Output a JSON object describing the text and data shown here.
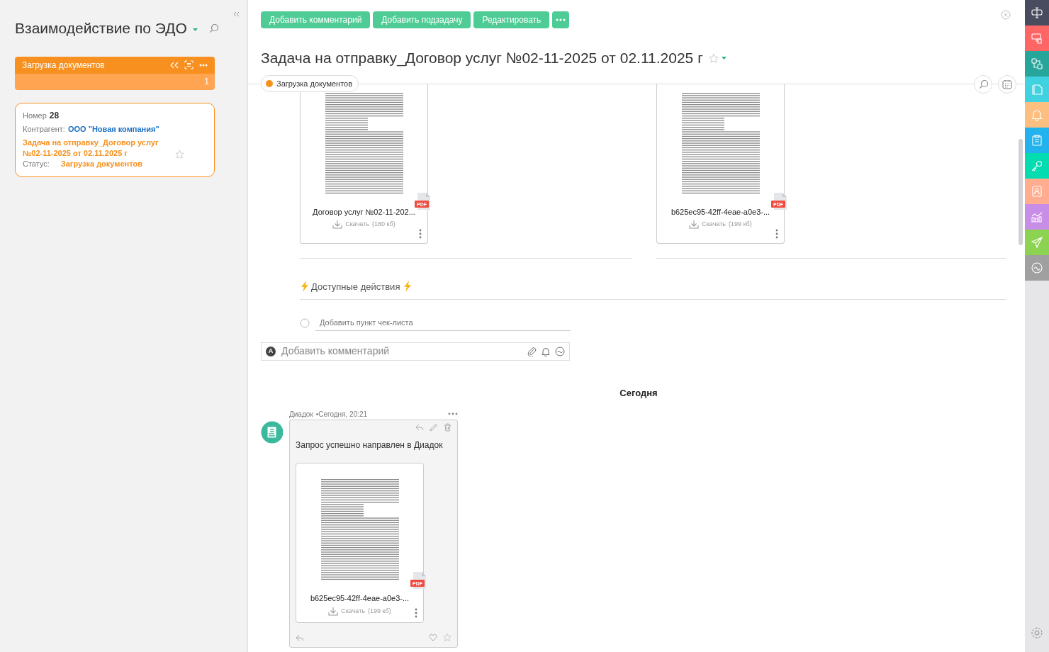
{
  "sidebar": {
    "title": "Взаимодействие по ЭДО",
    "column": {
      "title": "Загрузка документов",
      "count": "1"
    },
    "card": {
      "number_label": "Номер",
      "number": "28",
      "contractor_label": "Контрагент:",
      "contractor": "ООО \"Новая компания\"",
      "task": "Задача на отправку_Договор услуг №02-11-2025 от 02.11.2025 г",
      "starred": false,
      "status_label": "Статус:",
      "status": "Загрузка документов"
    }
  },
  "toolbar": {
    "buttons": [
      "Добавить комментарий",
      "Добавить подзадачу",
      "Редактировать"
    ]
  },
  "task": {
    "title": "Задача на отправку_Договор услуг №02-11-2025 от 02.11.2025 г",
    "starred": false,
    "status": {
      "label": "Загрузка документов",
      "color": "#f7901e"
    },
    "attachments": [
      {
        "name": "Договор услуг №02-11-202...",
        "type_badge": "PDF",
        "download": "Скачать",
        "size": "(180 кб)"
      },
      {
        "name": "b625ec95-42ff-4eae-a0e3-...",
        "type_badge": "PDF",
        "download": "Скачать",
        "size": "(199 кб)"
      }
    ],
    "actions_heading": "Доступные действия",
    "checklist": {
      "placeholder": "Добавить пункт чек-листа",
      "checked": false
    },
    "comment": {
      "avatar": "A",
      "placeholder": "Добавить комментарий"
    }
  },
  "feed": {
    "date_heading": "Сегодня",
    "messages": [
      {
        "author": "Диадок",
        "time": "•Сегодня, 20:21",
        "text": "Запрос успешно направлен в Диадок",
        "liked": false,
        "starred": false,
        "attachment": {
          "name": "b625ec95-42ff-4eae-a0e3-...",
          "type_badge": "PDF",
          "download": "Скачать",
          "size": "(199 кб)"
        }
      }
    ]
  },
  "rail": [
    {
      "kind": "layout",
      "color": "#484c5e"
    },
    {
      "kind": "chat",
      "color": "#fe6565"
    },
    {
      "kind": "flow",
      "color": "#26a59a"
    },
    {
      "kind": "docs",
      "color": "#40d2e0"
    },
    {
      "kind": "bell",
      "color": "#fcbf7f"
    },
    {
      "kind": "clipboard",
      "color": "#22b2ee"
    },
    {
      "kind": "key",
      "color": "#03dcb1"
    },
    {
      "kind": "contacts",
      "color": "#ffac8f"
    },
    {
      "kind": "chart",
      "color": "#c88de6"
    },
    {
      "kind": "send",
      "color": "#8cd352"
    },
    {
      "kind": "wave",
      "color": "#a0a0a0"
    }
  ]
}
